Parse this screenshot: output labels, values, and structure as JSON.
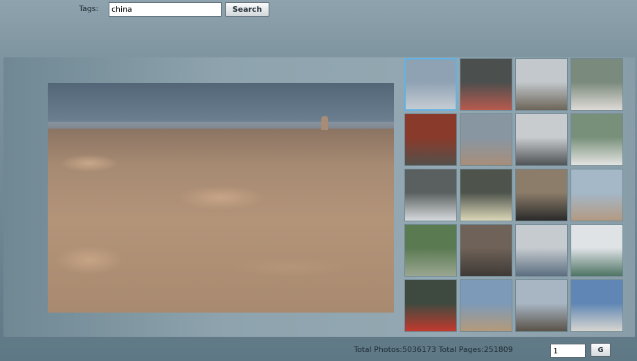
{
  "search": {
    "label": "Tags:",
    "value": "china",
    "button_label": "Search"
  },
  "main_photo": {
    "icon": "landscape-photo"
  },
  "thumbnails": [
    {
      "selected": true,
      "colors": [
        "#8fa2b4",
        "#c5ccd2"
      ]
    },
    {
      "selected": false,
      "colors": [
        "#4b4f4e",
        "#b85a4e"
      ]
    },
    {
      "selected": false,
      "colors": [
        "#c2c8cc",
        "#6d6559"
      ]
    },
    {
      "selected": false,
      "colors": [
        "#7a8a7c",
        "#dedad6"
      ]
    },
    {
      "selected": false,
      "colors": [
        "#8a3a2a",
        "#54504a"
      ]
    },
    {
      "selected": false,
      "colors": [
        "#8896a2",
        "#a88e7b"
      ]
    },
    {
      "selected": false,
      "colors": [
        "#c9ccce",
        "#4f5356"
      ]
    },
    {
      "selected": false,
      "colors": [
        "#78907a",
        "#e4e4e2"
      ]
    },
    {
      "selected": false,
      "colors": [
        "#5a5f5f",
        "#d6dadc"
      ]
    },
    {
      "selected": false,
      "colors": [
        "#4e544c",
        "#dcd7b8"
      ]
    },
    {
      "selected": false,
      "colors": [
        "#8c7d6a",
        "#2a2a2a"
      ]
    },
    {
      "selected": false,
      "colors": [
        "#a4b8c8",
        "#b39a82"
      ]
    },
    {
      "selected": false,
      "colors": [
        "#5a7a52",
        "#9aa690"
      ]
    },
    {
      "selected": false,
      "colors": [
        "#6f6258",
        "#3f3a36"
      ]
    },
    {
      "selected": false,
      "colors": [
        "#c6cbcf",
        "#5b6e80"
      ]
    },
    {
      "selected": false,
      "colors": [
        "#dfe3e6",
        "#4e7464"
      ]
    },
    {
      "selected": false,
      "colors": [
        "#3e4a40",
        "#c23a2e"
      ]
    },
    {
      "selected": false,
      "colors": [
        "#7d9ab8",
        "#b49a7a"
      ]
    },
    {
      "selected": false,
      "colors": [
        "#a8b6c4",
        "#5a5248"
      ]
    },
    {
      "selected": false,
      "colors": [
        "#5f86b4",
        "#d8d6d0"
      ]
    }
  ],
  "footer": {
    "total_text": "Total Photos:5036173 Total Pages:251809",
    "page_value": "1",
    "go_label": "G"
  }
}
